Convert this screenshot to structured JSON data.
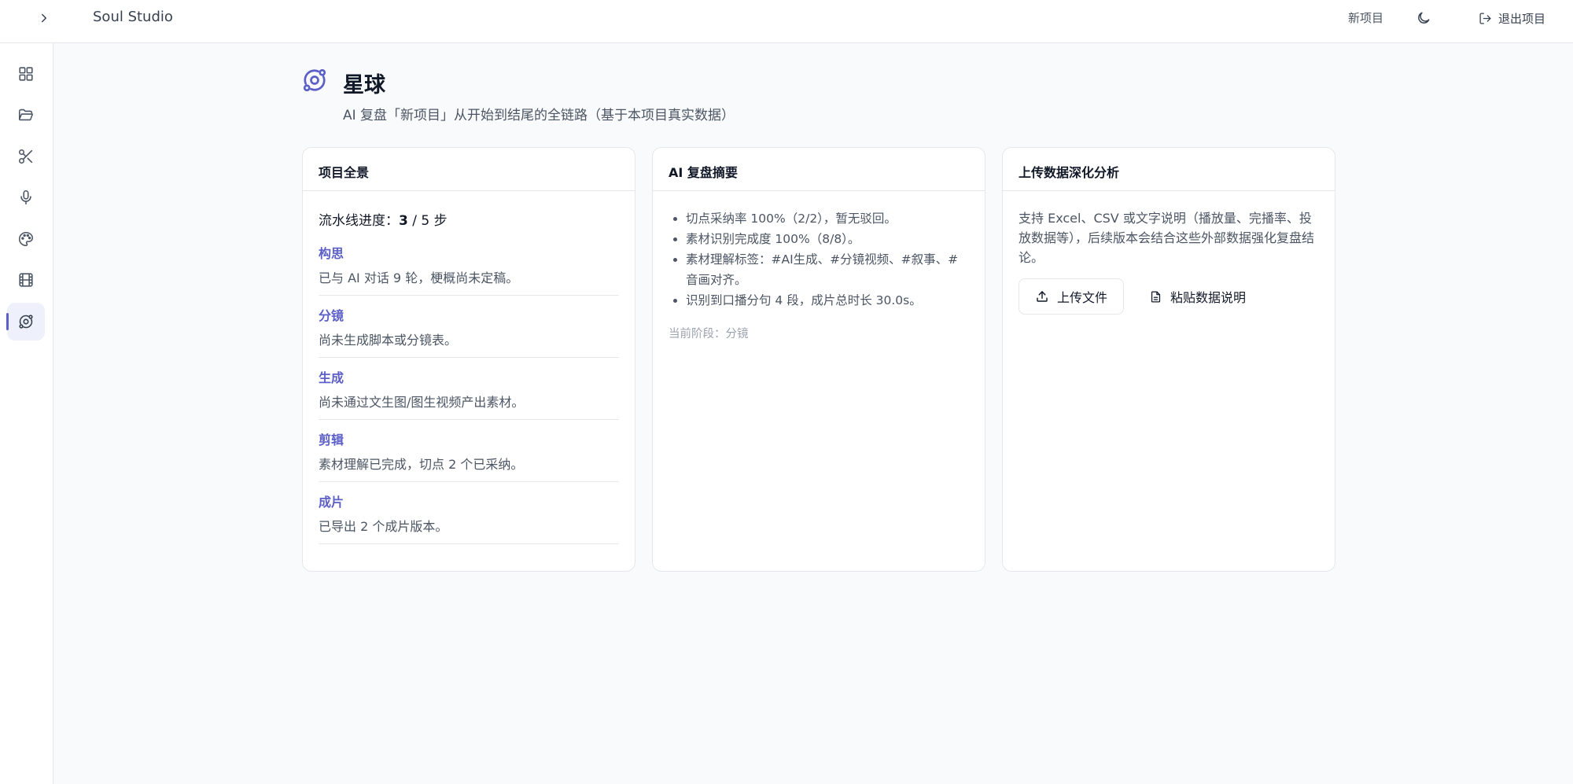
{
  "header": {
    "app_title": "Soul Studio",
    "project_name": "新项目",
    "exit_label": "退出项目"
  },
  "sidebar": {
    "items": [
      {
        "icon": "grid-icon",
        "active": false
      },
      {
        "icon": "folder-open-icon",
        "active": false
      },
      {
        "icon": "scissors-icon",
        "active": false
      },
      {
        "icon": "microphone-icon",
        "active": false
      },
      {
        "icon": "palette-icon",
        "active": false
      },
      {
        "icon": "film-icon",
        "active": false
      },
      {
        "icon": "orbit-icon",
        "active": true
      }
    ]
  },
  "page": {
    "title": "星球",
    "subtitle": "AI 复盘「新项目」从开始到结尾的全链路（基于本项目真实数据）"
  },
  "overview": {
    "title": "项目全景",
    "progress_prefix": "流水线进度：",
    "progress_current": "3",
    "progress_suffix": " / 5 步",
    "stages": [
      {
        "name": "构思",
        "desc": "已与 AI 对话 9 轮，梗概尚未定稿。"
      },
      {
        "name": "分镜",
        "desc": "尚未生成脚本或分镜表。"
      },
      {
        "name": "生成",
        "desc": "尚未通过文生图/图生视频产出素材。"
      },
      {
        "name": "剪辑",
        "desc": "素材理解已完成，切点 2 个已采纳。"
      },
      {
        "name": "成片",
        "desc": "已导出 2 个成片版本。"
      }
    ]
  },
  "summary": {
    "title": "AI 复盘摘要",
    "items": [
      "切点采纳率 100%（2/2），暂无驳回。",
      "素材识别完成度 100%（8/8）。",
      "素材理解标签：#AI生成、#分镜视频、#叙事、#音画对齐。",
      "识别到口播分句 4 段，成片总时长 30.0s。"
    ],
    "current_stage": "当前阶段：分镜"
  },
  "upload": {
    "title": "上传数据深化分析",
    "desc": "支持 Excel、CSV 或文字说明（播放量、完播率、投放数据等），后续版本会结合这些外部数据强化复盘结论。",
    "upload_button": "上传文件",
    "paste_button": "粘贴数据说明"
  },
  "colors": {
    "accent": "#5b5fc7",
    "background": "#f9fafb",
    "border": "#e5e7eb"
  }
}
